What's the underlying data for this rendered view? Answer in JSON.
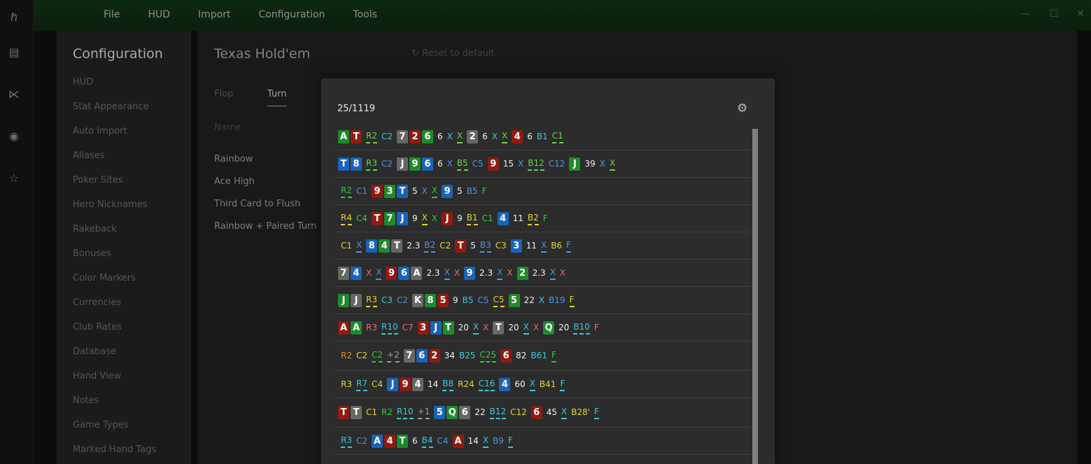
{
  "menu": [
    "File",
    "HUD",
    "Import",
    "Configuration",
    "Tools"
  ],
  "rail_icons": [
    "logo-icon",
    "document-icon",
    "share-icon",
    "broadcast-icon",
    "star-list-icon"
  ],
  "window_controls": [
    "minimize-icon",
    "maximize-icon",
    "close-icon"
  ],
  "config": {
    "title": "Configuration",
    "items": [
      "HUD",
      "Stat Appearance",
      "Auto Import",
      "Aliases",
      "Poker Sites",
      "Hero Nicknames",
      "Rakeback",
      "Bonuses",
      "Color Markers",
      "Currencies",
      "Club Rates",
      "Database",
      "Hand View",
      "Notes",
      "Game Types",
      "Marked Hand Tags"
    ]
  },
  "main": {
    "title": "Texas Hold'em",
    "reset": "Reset to default",
    "tabs": [
      "Flop",
      "Turn"
    ],
    "active_tab": "Turn",
    "name_label": "Name",
    "categories": [
      "Rainbow",
      "Ace High",
      "Third Card to Flush",
      "Rainbow + Paired Turn"
    ]
  },
  "modal": {
    "counter": "25/1119",
    "rows": [
      [
        [
          "c",
          "A",
          "green"
        ],
        [
          "c",
          "T",
          "red"
        ],
        [
          "g"
        ],
        [
          "t",
          "R2",
          "lime",
          1
        ],
        [
          "t",
          "C2",
          "cyan",
          0
        ],
        [
          "c",
          "7",
          "gray"
        ],
        [
          "c",
          "2",
          "red"
        ],
        [
          "c",
          "6",
          "green"
        ],
        [
          "g"
        ],
        [
          "t",
          "6",
          "white",
          0
        ],
        [
          "t",
          "X",
          "cyan",
          0
        ],
        [
          "t",
          "X",
          "lime",
          1
        ],
        [
          "c",
          "2",
          "gray"
        ],
        [
          "g"
        ],
        [
          "t",
          "6",
          "white",
          0
        ],
        [
          "t",
          "X",
          "cyan",
          0
        ],
        [
          "t",
          "X",
          "lime",
          1
        ],
        [
          "c",
          "4",
          "red"
        ],
        [
          "g"
        ],
        [
          "t",
          "6",
          "white",
          0
        ],
        [
          "t",
          "B1",
          "cyan",
          0
        ],
        [
          "t",
          "C1",
          "lime",
          1
        ]
      ],
      [
        [
          "c",
          "T",
          "blue"
        ],
        [
          "c",
          "8",
          "blue"
        ],
        [
          "g"
        ],
        [
          "t",
          "R3",
          "lime",
          1
        ],
        [
          "t",
          "C2",
          "blue",
          0
        ],
        [
          "c",
          "J",
          "gray"
        ],
        [
          "c",
          "9",
          "green"
        ],
        [
          "c",
          "6",
          "blue"
        ],
        [
          "g"
        ],
        [
          "t",
          "6",
          "white",
          0
        ],
        [
          "t",
          "X",
          "blue",
          0
        ],
        [
          "t",
          "B5",
          "lime",
          1
        ],
        [
          "t",
          "C5",
          "blue",
          0
        ],
        [
          "c",
          "9",
          "red"
        ],
        [
          "g"
        ],
        [
          "t",
          "15",
          "white",
          0
        ],
        [
          "t",
          "X",
          "blue",
          0
        ],
        [
          "t",
          "B12",
          "lime",
          1
        ],
        [
          "t",
          "C12",
          "blue",
          0
        ],
        [
          "c",
          "J",
          "green"
        ],
        [
          "g"
        ],
        [
          "t",
          "39",
          "white",
          0
        ],
        [
          "t",
          "X",
          "blue",
          0
        ],
        [
          "t",
          "X",
          "lime",
          1
        ]
      ],
      [
        [
          "g"
        ],
        [
          "t",
          "R2",
          "green",
          1
        ],
        [
          "t",
          "C1",
          "blue",
          0
        ],
        [
          "c",
          "9",
          "red"
        ],
        [
          "c",
          "3",
          "green"
        ],
        [
          "c",
          "T",
          "blue"
        ],
        [
          "g"
        ],
        [
          "t",
          "5",
          "white",
          0
        ],
        [
          "t",
          "X",
          "blue",
          0
        ],
        [
          "t",
          "X",
          "green",
          1
        ],
        [
          "c",
          "9",
          "blue"
        ],
        [
          "g"
        ],
        [
          "t",
          "5",
          "white",
          0
        ],
        [
          "t",
          "B5",
          "blue",
          0
        ],
        [
          "t",
          "F",
          "green",
          0
        ]
      ],
      [
        [
          "g"
        ],
        [
          "t",
          "R4",
          "yellow",
          1
        ],
        [
          "t",
          "C4",
          "green",
          0
        ],
        [
          "c",
          "T",
          "red"
        ],
        [
          "c",
          "7",
          "green"
        ],
        [
          "c",
          "J",
          "blue"
        ],
        [
          "g"
        ],
        [
          "t",
          "9",
          "white",
          0
        ],
        [
          "t",
          "X",
          "yellow",
          1
        ],
        [
          "t",
          "X",
          "green",
          0
        ],
        [
          "c",
          "J",
          "red"
        ],
        [
          "g"
        ],
        [
          "t",
          "9",
          "white",
          0
        ],
        [
          "t",
          "B1",
          "yellow",
          1
        ],
        [
          "t",
          "C1",
          "green",
          0
        ],
        [
          "c",
          "4",
          "blue"
        ],
        [
          "g"
        ],
        [
          "t",
          "11",
          "white",
          0
        ],
        [
          "t",
          "B2",
          "yellow",
          1
        ],
        [
          "t",
          "F",
          "green",
          0
        ]
      ],
      [
        [
          "g"
        ],
        [
          "t",
          "C1",
          "yellow",
          0
        ],
        [
          "t",
          "X",
          "blue",
          1
        ],
        [
          "c",
          "8",
          "blue"
        ],
        [
          "c",
          "4",
          "green"
        ],
        [
          "c",
          "T",
          "gray"
        ],
        [
          "g"
        ],
        [
          "t",
          "2.3",
          "white",
          0
        ],
        [
          "t",
          "B2",
          "blue",
          1
        ],
        [
          "t",
          "C2",
          "yellow",
          0
        ],
        [
          "c",
          "T",
          "red"
        ],
        [
          "g"
        ],
        [
          "t",
          "5",
          "white",
          0
        ],
        [
          "t",
          "B3",
          "blue",
          1
        ],
        [
          "t",
          "C3",
          "yellow",
          0
        ],
        [
          "c",
          "3",
          "blue"
        ],
        [
          "g"
        ],
        [
          "t",
          "11",
          "white",
          0
        ],
        [
          "t",
          "X",
          "blue",
          1
        ],
        [
          "t",
          "B6",
          "yellow",
          0
        ],
        [
          "t",
          "F",
          "blue",
          1
        ]
      ],
      [
        [
          "c",
          "7",
          "gray"
        ],
        [
          "c",
          "4",
          "blue"
        ],
        [
          "g"
        ],
        [
          "t",
          "X",
          "salmon",
          0
        ],
        [
          "t",
          "X",
          "blue",
          1
        ],
        [
          "c",
          "9",
          "red"
        ],
        [
          "c",
          "6",
          "blue"
        ],
        [
          "c",
          "A",
          "gray"
        ],
        [
          "g"
        ],
        [
          "t",
          "2.3",
          "white",
          0
        ],
        [
          "t",
          "X",
          "blue",
          1
        ],
        [
          "t",
          "X",
          "salmon",
          0
        ],
        [
          "c",
          "9",
          "blue"
        ],
        [
          "g"
        ],
        [
          "t",
          "2.3",
          "white",
          0
        ],
        [
          "t",
          "X",
          "blue",
          1
        ],
        [
          "t",
          "X",
          "salmon",
          0
        ],
        [
          "c",
          "2",
          "green"
        ],
        [
          "g"
        ],
        [
          "t",
          "2.3",
          "white",
          0
        ],
        [
          "t",
          "X",
          "blue",
          1
        ],
        [
          "t",
          "X",
          "salmon",
          0
        ]
      ],
      [
        [
          "c",
          "J",
          "green"
        ],
        [
          "c",
          "J",
          "gray"
        ],
        [
          "g"
        ],
        [
          "t",
          "R3",
          "yellow",
          1
        ],
        [
          "t",
          "C3",
          "cyan",
          0
        ],
        [
          "t",
          "C2",
          "blue",
          0
        ],
        [
          "c",
          "K",
          "gray"
        ],
        [
          "c",
          "8",
          "green"
        ],
        [
          "c",
          "5",
          "red"
        ],
        [
          "g"
        ],
        [
          "t",
          "9",
          "white",
          0
        ],
        [
          "t",
          "B5",
          "cyan",
          0
        ],
        [
          "t",
          "C5",
          "blue",
          0
        ],
        [
          "t",
          "C5",
          "yellow",
          1
        ],
        [
          "c",
          "5",
          "green"
        ],
        [
          "g"
        ],
        [
          "t",
          "22",
          "white",
          0
        ],
        [
          "t",
          "X",
          "cyan",
          0
        ],
        [
          "t",
          "B19",
          "blue",
          0
        ],
        [
          "t",
          "F",
          "yellow",
          1
        ]
      ],
      [
        [
          "c",
          "A",
          "red"
        ],
        [
          "c",
          "A",
          "green"
        ],
        [
          "g"
        ],
        [
          "t",
          "R3",
          "salmon",
          0
        ],
        [
          "t",
          "R10",
          "cyan",
          1
        ],
        [
          "t",
          "C7",
          "salmon",
          0
        ],
        [
          "c",
          "3",
          "red"
        ],
        [
          "c",
          "J",
          "blue"
        ],
        [
          "c",
          "T",
          "green"
        ],
        [
          "g"
        ],
        [
          "t",
          "20",
          "white",
          0
        ],
        [
          "t",
          "X",
          "cyan",
          1
        ],
        [
          "t",
          "X",
          "salmon",
          0
        ],
        [
          "c",
          "T",
          "gray"
        ],
        [
          "g"
        ],
        [
          "t",
          "20",
          "white",
          0
        ],
        [
          "t",
          "X",
          "cyan",
          1
        ],
        [
          "t",
          "X",
          "salmon",
          0
        ],
        [
          "c",
          "Q",
          "green"
        ],
        [
          "g"
        ],
        [
          "t",
          "20",
          "white",
          0
        ],
        [
          "t",
          "B10",
          "cyan",
          1
        ],
        [
          "t",
          "F",
          "salmon",
          0
        ]
      ],
      [
        [
          "g"
        ],
        [
          "t",
          "R2",
          "orange",
          0
        ],
        [
          "t",
          "C2",
          "yellow",
          0
        ],
        [
          "t",
          "C2",
          "green",
          1
        ],
        [
          "t",
          "+2",
          "gray",
          1
        ],
        [
          "c",
          "7",
          "gray"
        ],
        [
          "c",
          "6",
          "blue"
        ],
        [
          "c",
          "2",
          "red"
        ],
        [
          "g"
        ],
        [
          "t",
          "34",
          "white",
          0
        ],
        [
          "t",
          "B25",
          "cyan",
          0
        ],
        [
          "t",
          "C25",
          "green",
          1
        ],
        [
          "c",
          "6",
          "red"
        ],
        [
          "g"
        ],
        [
          "t",
          "82",
          "white",
          0
        ],
        [
          "t",
          "B61",
          "cyan",
          0
        ],
        [
          "t",
          "F",
          "green",
          1
        ]
      ],
      [
        [
          "g"
        ],
        [
          "t",
          "R3",
          "yellow",
          0
        ],
        [
          "t",
          "R7",
          "cyan",
          1
        ],
        [
          "t",
          "C4",
          "yellow",
          0
        ],
        [
          "c",
          "J",
          "blue"
        ],
        [
          "c",
          "9",
          "red"
        ],
        [
          "c",
          "4",
          "gray"
        ],
        [
          "g"
        ],
        [
          "t",
          "14",
          "white",
          0
        ],
        [
          "t",
          "B8",
          "cyan",
          1
        ],
        [
          "t",
          "R24",
          "yellow",
          0
        ],
        [
          "t",
          "C16",
          "cyan",
          1
        ],
        [
          "c",
          "4",
          "blue"
        ],
        [
          "g"
        ],
        [
          "t",
          "60",
          "white",
          0
        ],
        [
          "t",
          "X",
          "cyan",
          1
        ],
        [
          "t",
          "B41",
          "yellow",
          0
        ],
        [
          "t",
          "F",
          "cyan",
          1
        ]
      ],
      [
        [
          "c",
          "T",
          "red"
        ],
        [
          "c",
          "T",
          "gray"
        ],
        [
          "g"
        ],
        [
          "t",
          "C1",
          "yellow",
          0
        ],
        [
          "t",
          "R2",
          "green",
          0
        ],
        [
          "t",
          "R10",
          "cyan",
          1
        ],
        [
          "t",
          "+1",
          "gray",
          1
        ],
        [
          "c",
          "5",
          "blue"
        ],
        [
          "c",
          "Q",
          "green"
        ],
        [
          "c",
          "6",
          "gray"
        ],
        [
          "g"
        ],
        [
          "t",
          "22",
          "white",
          0
        ],
        [
          "t",
          "B12",
          "cyan",
          1
        ],
        [
          "t",
          "C12",
          "yellow",
          0
        ],
        [
          "c",
          "6",
          "red"
        ],
        [
          "g"
        ],
        [
          "t",
          "45",
          "white",
          0
        ],
        [
          "t",
          "X",
          "cyan",
          1
        ],
        [
          "t",
          "B28'",
          "yellow",
          0
        ],
        [
          "t",
          "F",
          "cyan",
          1
        ]
      ],
      [
        [
          "g"
        ],
        [
          "t",
          "R3",
          "cyan",
          1
        ],
        [
          "t",
          "C2",
          "blue",
          0
        ],
        [
          "c",
          "A",
          "blue"
        ],
        [
          "c",
          "4",
          "red"
        ],
        [
          "c",
          "T",
          "green"
        ],
        [
          "g"
        ],
        [
          "t",
          "6",
          "white",
          0
        ],
        [
          "t",
          "B4",
          "cyan",
          1
        ],
        [
          "t",
          "C4",
          "blue",
          0
        ],
        [
          "c",
          "A",
          "red"
        ],
        [
          "g"
        ],
        [
          "t",
          "14",
          "white",
          0
        ],
        [
          "t",
          "X",
          "cyan",
          1
        ],
        [
          "t",
          "B9",
          "blue",
          0
        ],
        [
          "t",
          "F",
          "cyan",
          1
        ]
      ]
    ]
  }
}
